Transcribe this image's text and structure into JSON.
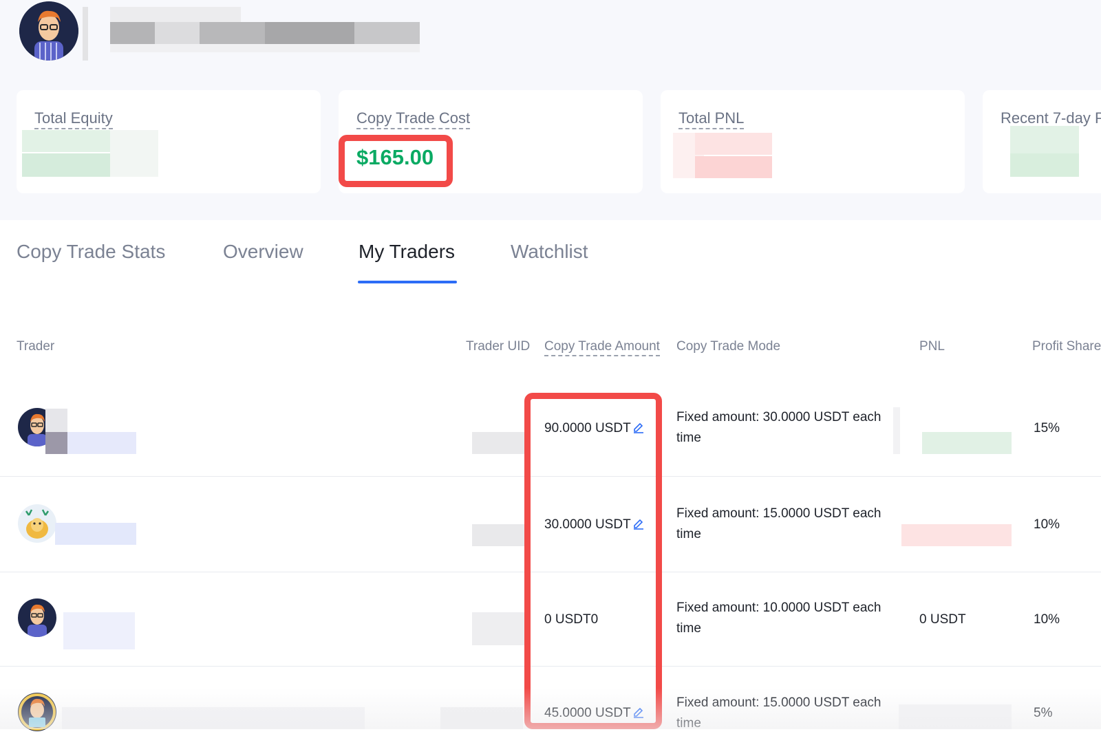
{
  "cards": [
    {
      "label": "Total Equity"
    },
    {
      "label": "Copy Trade Cost",
      "value": "$165.00"
    },
    {
      "label": "Total PNL"
    },
    {
      "label": "Recent 7-day P"
    }
  ],
  "tabs": [
    {
      "label": "Copy Trade Stats",
      "active": false
    },
    {
      "label": "Overview",
      "active": false
    },
    {
      "label": "My Traders",
      "active": true
    },
    {
      "label": "Watchlist",
      "active": false
    }
  ],
  "table": {
    "headers": {
      "trader": "Trader",
      "uid": "Trader UID",
      "amount": "Copy Trade Amount",
      "mode": "Copy Trade Mode",
      "pnl": "PNL",
      "profit_share": "Profit Share"
    },
    "rows": [
      {
        "amount": "90.0000 USDT",
        "mode": "Fixed amount: 30.0000 USDT each time",
        "pnl": "",
        "profit_share": "15%"
      },
      {
        "amount": "30.0000 USDT",
        "mode": "Fixed amount: 15.0000 USDT each time",
        "pnl": "",
        "profit_share": "10%"
      },
      {
        "amount": "0 USDT0",
        "mode": "Fixed amount: 10.0000 USDT each time",
        "pnl": "0 USDT",
        "profit_share": "10%"
      },
      {
        "amount": "45.0000 USDT",
        "mode": "Fixed amount: 15.0000 USDT each time",
        "pnl": "",
        "profit_share": "5%"
      }
    ]
  },
  "colors": {
    "accent_blue": "#2c6cf6",
    "positive_green": "#0aaa63",
    "highlight_red": "#f24a48"
  },
  "icons": [
    "edit-pencil-icon",
    "avatar"
  ]
}
